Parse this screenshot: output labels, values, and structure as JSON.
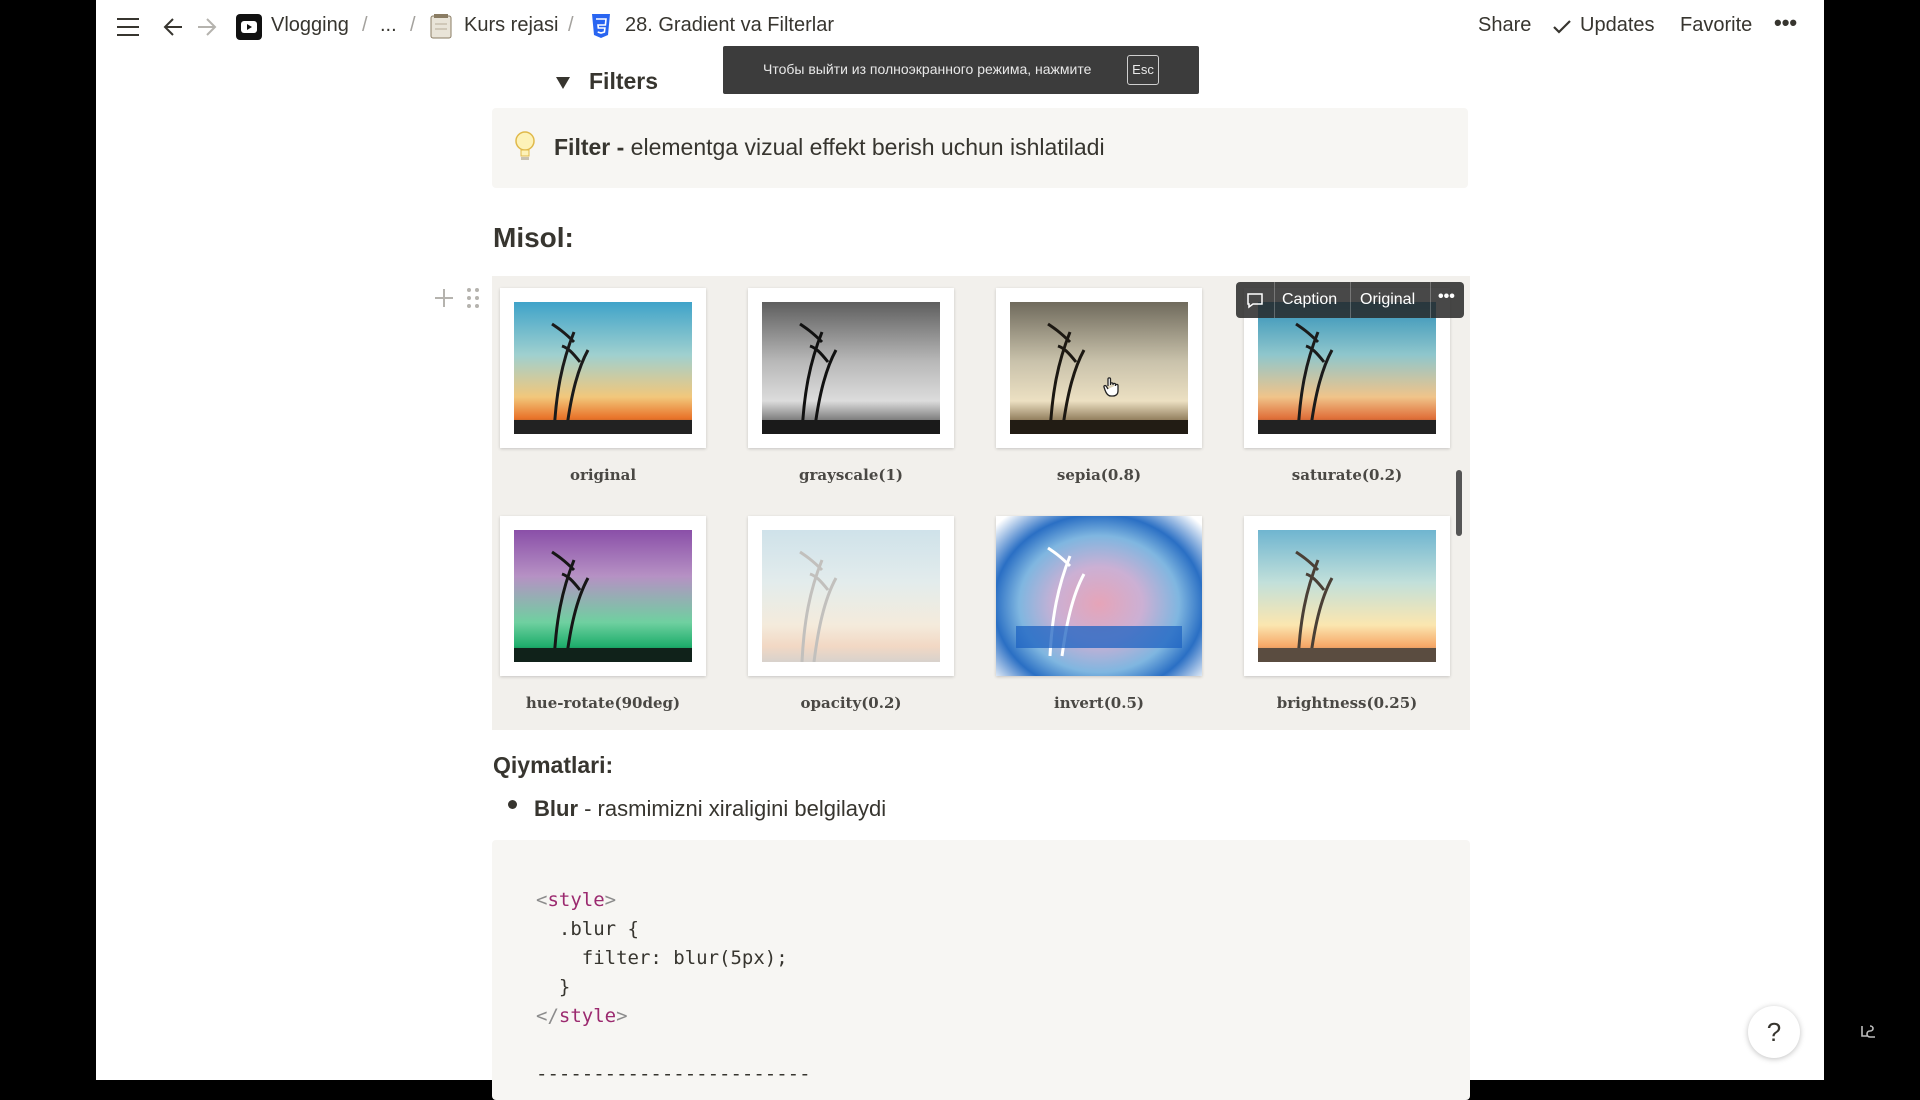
{
  "topbar": {
    "breadcrumb": [
      "Vlogging",
      "...",
      "Kurs rejasi",
      "28. Gradient va Filterlar"
    ],
    "separator": "/",
    "share": "Share",
    "updates": "Updates",
    "favorite": "Favorite",
    "more": "•••"
  },
  "toast": {
    "text": "Чтобы выйти из полноэкранного режима, нажмите",
    "key": "Esc"
  },
  "toggle": {
    "title": "Filters"
  },
  "callout": {
    "bold": "Filter - ",
    "text": "elementga vizual effekt berish uchun ishlatiladi"
  },
  "misol_heading": "Misol:",
  "image_toolbar": {
    "caption": "Caption",
    "original": "Original",
    "more": "•••"
  },
  "thumbnails": [
    {
      "caption": "original"
    },
    {
      "caption": "grayscale(1)"
    },
    {
      "caption": "sepia(0.8)"
    },
    {
      "caption": "saturate(0.2)"
    },
    {
      "caption": "hue-rotate(90deg)"
    },
    {
      "caption": "opacity(0.2)"
    },
    {
      "caption": "invert(0.5)"
    },
    {
      "caption": "brightness(0.25)"
    }
  ],
  "qiymatlari_heading": "Qiymatlari:",
  "bullet": {
    "bold": "Blur",
    "text": " - rasmimizni xiraligini belgilaydi"
  },
  "code": {
    "line1_open": "<",
    "line1_tag": "style",
    "line1_close": ">",
    "line2": "  .blur {",
    "line3": "    filter: blur(5px);",
    "line4": "  }",
    "line5_open": "</",
    "line5_tag": "style",
    "line5_close": ">",
    "line7": "------------------------"
  },
  "help": "?",
  "colors": {
    "page_bg": "#ffffff",
    "callout_bg": "#f7f6f3",
    "code_tag": "#9b2a6f",
    "text": "#37352f"
  }
}
